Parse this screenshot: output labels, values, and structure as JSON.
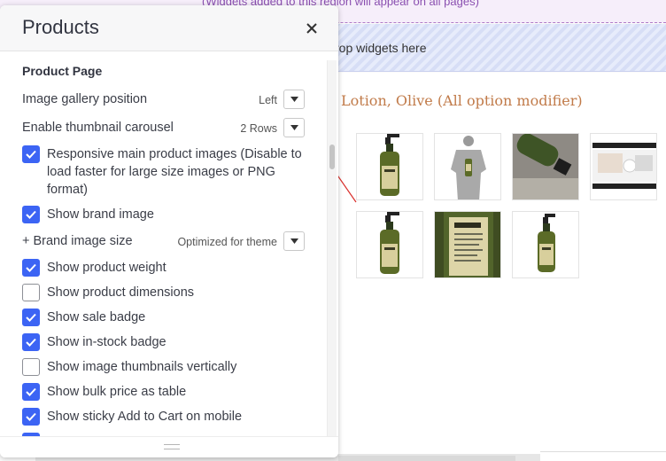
{
  "background": {
    "region_notice": "(Widgets added to this region will appear on all pages)",
    "drop_zone_text": "rop widgets here",
    "product_title": "Lotion, Olive (All option modifier)",
    "thumbnail_names": [
      "product-bottle-thumbnail",
      "mannequin-thumbnail",
      "bottle-on-rock-thumbnail",
      "website-screenshot-thumbnail",
      "product-bottle-thumbnail",
      "bottle-label-closeup-thumbnail",
      "product-bottle-thumbnail"
    ]
  },
  "panel": {
    "title": "Products",
    "close_icon": "close-icon",
    "section_heading": "Product Page",
    "image_gallery": {
      "label": "Image gallery position",
      "value": "Left"
    },
    "thumbnail_carousel": {
      "label": "Enable thumbnail carousel",
      "value": "2 Rows"
    },
    "brand_image_size": {
      "label": "+ Brand image size",
      "value": "Optimized for theme"
    },
    "checkboxes": [
      {
        "label": "Responsive main product images (Disable to load faster for large size images or PNG format)",
        "checked": true
      },
      {
        "label": "Show brand image",
        "checked": true
      },
      {
        "label": "Show product weight",
        "checked": true
      },
      {
        "label": "Show product dimensions",
        "checked": false
      },
      {
        "label": "Show sale badge",
        "checked": true
      },
      {
        "label": "Show in-stock badge",
        "checked": true
      },
      {
        "label": "Show image thumbnails vertically",
        "checked": false
      },
      {
        "label": "Show bulk price as table",
        "checked": true
      },
      {
        "label": "Show sticky Add to Cart on mobile",
        "checked": true
      }
    ]
  },
  "colors": {
    "accent": "#3c64f4",
    "annotation_arrow": "#d9302c",
    "product_title": "#c17b4a"
  }
}
